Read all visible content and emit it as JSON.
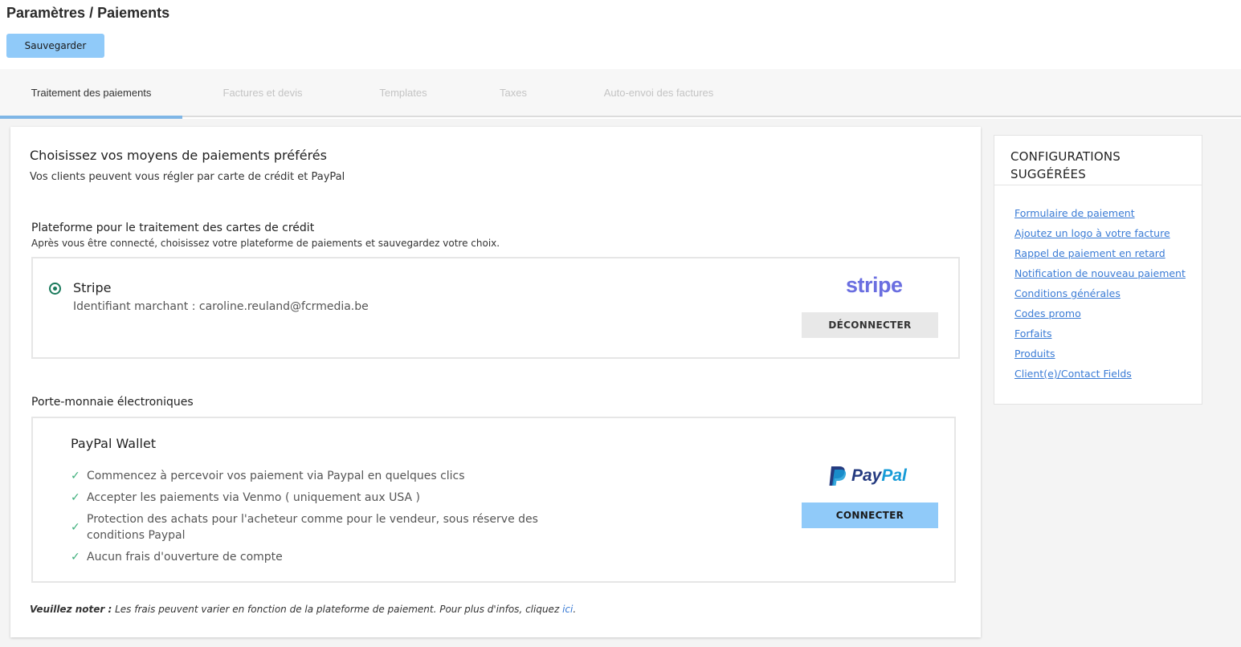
{
  "page": {
    "title": "Paramètres / Paiements",
    "save_label": "Sauvegarder"
  },
  "tabs": [
    {
      "label": "Traitement des paiements",
      "active": true
    },
    {
      "label": "Factures et devis",
      "active": false
    },
    {
      "label": "Templates",
      "active": false
    },
    {
      "label": "Taxes",
      "active": false
    },
    {
      "label": "Auto-envoi des factures",
      "active": false
    }
  ],
  "main": {
    "title": "Choisissez vos moyens de paiements préférés",
    "subtitle": "Vos clients peuvent vous régler par carte de crédit et PayPal",
    "card_section": {
      "title": "Plateforme pour le traitement des cartes de crédit",
      "description": "Après vous être connecté, choisissez votre plateforme de paiements et sauvegardez votre choix.",
      "provider": {
        "name": "Stripe",
        "merchant_id": "Identifiant marchant : caroline.reuland@fcrmedia.be",
        "logo_text": "stripe",
        "selected": true,
        "disconnect_label": "DÉCONNECTER"
      }
    },
    "wallet_section": {
      "title": "Porte-monnaie électroniques",
      "wallet": {
        "name": "PayPal Wallet",
        "features": [
          "Commencez à percevoir vos paiement via Paypal en quelques clics",
          "Accepter les paiements via Venmo ( uniquement aux USA )",
          "Protection des achats pour l'acheteur comme pour le vendeur, sous réserve des conditions Paypal",
          "Aucun frais d'ouverture de compte"
        ],
        "logo_pay": "Pay",
        "logo_pal": "Pal",
        "connect_label": "CONNECTER"
      }
    },
    "note": {
      "prefix": "Veuillez noter :",
      "text": " Les frais peuvent varier en fonction de la plateforme de paiement. Pour plus d'infos, cliquez ",
      "link": "ici",
      "suffix": "."
    }
  },
  "sidebar": {
    "title": "CONFIGURATIONS SUGGÉRÉES",
    "links": [
      "Formulaire de paiement",
      "Ajoutez un logo à votre facture",
      "Rappel de paiement en retard",
      "Notification de nouveau paiement",
      "Conditions générales",
      "Codes promo",
      "Forfaits",
      "Produits",
      "Client(e)/Contact Fields"
    ]
  },
  "colors": {
    "accent_button": "#90caf9",
    "tab_underline": "#7fb6e6",
    "radio_selected": "#1a7a5c",
    "check": "#3cae7a",
    "link": "#3a7bd5",
    "stripe_brand": "#6a6ee0",
    "paypal_dark": "#253b80",
    "paypal_light": "#179bd7"
  }
}
